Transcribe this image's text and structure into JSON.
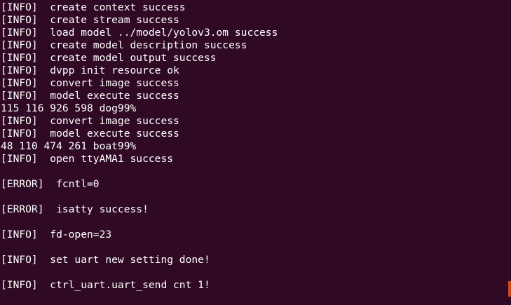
{
  "terminal": {
    "lines": [
      "[INFO]  create context success",
      "[INFO]  create stream success",
      "[INFO]  load model ../model/yolov3.om success",
      "[INFO]  create model description success",
      "[INFO]  create model output success",
      "[INFO]  dvpp init resource ok",
      "[INFO]  convert image success",
      "[INFO]  model execute success",
      "115 116 926 598 dog99%",
      "[INFO]  convert image success",
      "[INFO]  model execute success",
      "48 110 474 261 boat99%",
      "[INFO]  open ttyAMA1 success",
      "",
      "[ERROR]  fcntl=0",
      "",
      "[ERROR]  isatty success!",
      "",
      "[INFO]  fd-open=23",
      "",
      "[INFO]  set uart new setting done!",
      "",
      "[INFO]  ctrl_uart.uart_send cnt 1!"
    ],
    "colors": {
      "background": "#300a24",
      "text": "#ffffff",
      "cursor": "#e95420"
    }
  }
}
